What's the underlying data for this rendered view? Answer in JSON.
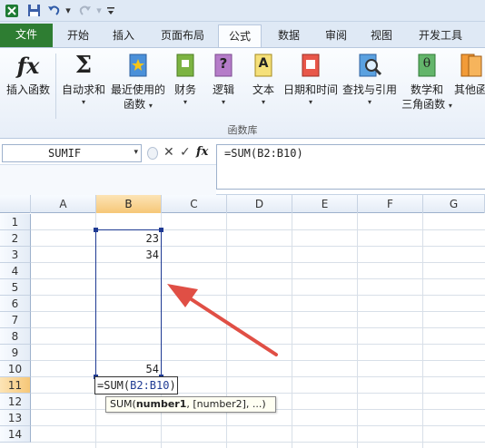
{
  "quick_access": {
    "icons": [
      "excel-icon",
      "save-icon",
      "undo-icon",
      "redo-icon",
      "customize-icon"
    ]
  },
  "tabs": [
    {
      "label": "文件",
      "active": false
    },
    {
      "label": "开始",
      "active": false
    },
    {
      "label": "插入",
      "active": false
    },
    {
      "label": "页面布局",
      "active": false
    },
    {
      "label": "公式",
      "active": true
    },
    {
      "label": "数据",
      "active": false
    },
    {
      "label": "审阅",
      "active": false
    },
    {
      "label": "视图",
      "active": false
    },
    {
      "label": "开发工具",
      "active": false
    }
  ],
  "ribbon": {
    "insert_function": {
      "label": "插入函数",
      "glyph": "fx"
    },
    "autosum": {
      "line1": "自动求和",
      "glyph": "Σ"
    },
    "recently_used": {
      "line1": "最近使用的",
      "line2": "函数"
    },
    "financial": {
      "line1": "财务"
    },
    "logical": {
      "line1": "逻辑",
      "glyph": "?"
    },
    "text": {
      "line1": "文本",
      "glyph": "A"
    },
    "date_time": {
      "line1": "日期和时间"
    },
    "lookup_reference": {
      "line1": "查找与引用"
    },
    "math_trig": {
      "line1": "数学和",
      "line2": "三角函数",
      "glyph": "θ"
    },
    "more_functions": {
      "line1": "其他函"
    },
    "group_label": "函数库",
    "dropdown_arrow": "▾"
  },
  "formula_bar": {
    "name_box": "SUMIF",
    "name_dropdown": "▾",
    "cancel_glyph": "✕",
    "enter_glyph": "✓",
    "fx_glyph": "fx",
    "formula": "=SUM(B2:B10)"
  },
  "columns": [
    "A",
    "B",
    "C",
    "D",
    "E",
    "F",
    "G"
  ],
  "rows": [
    "1",
    "2",
    "3",
    "4",
    "5",
    "6",
    "7",
    "8",
    "9",
    "10",
    "11",
    "12",
    "13",
    "14"
  ],
  "cells": {
    "B2": "23",
    "B3": "34",
    "B10": "54"
  },
  "edit_cell": {
    "prefix": "=SUM(",
    "range": "B2:B10",
    "suffix": ")"
  },
  "tooltip": {
    "prefix": "SUM(",
    "bold_arg": "number1",
    "rest": ", [number2], ...)"
  },
  "colors": {
    "range_border": "#1f3a93",
    "arrow": "#e04f45",
    "file_tab": "#2e7d32",
    "header_selected": "#f6c777"
  }
}
